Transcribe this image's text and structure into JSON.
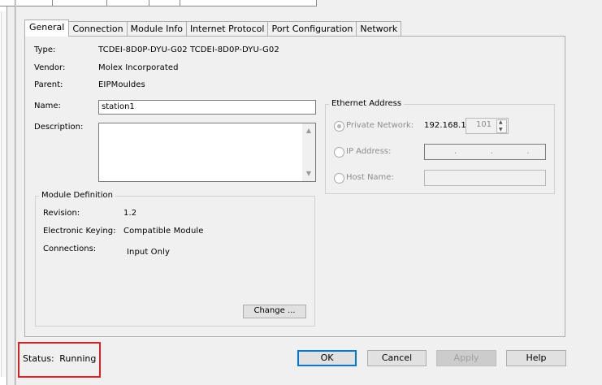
{
  "tabs": [
    {
      "label": "General",
      "active": true
    },
    {
      "label": "Connection",
      "active": false
    },
    {
      "label": "Module Info",
      "active": false
    },
    {
      "label": "Internet Protocol",
      "active": false
    },
    {
      "label": "Port Configuration",
      "active": false
    },
    {
      "label": "Network",
      "active": false
    }
  ],
  "general": {
    "type_label": "Type:",
    "type_value": "TCDEI-8D0P-DYU-G02 TCDEI-8D0P-DYU-G02",
    "vendor_label": "Vendor:",
    "vendor_value": "Molex Incorporated",
    "parent_label": "Parent:",
    "parent_value": "EIPMouldes",
    "name_label": "Name:",
    "name_value": "station1",
    "description_label": "Description:",
    "description_value": ""
  },
  "module_definition": {
    "title": "Module Definition",
    "revision_label": "Revision:",
    "revision_value": "1.2",
    "keying_label": "Electronic Keying:",
    "keying_value": "Compatible Module",
    "connections_label": "Connections:",
    "connections_value": "Input Only",
    "change_button": "Change ..."
  },
  "ethernet_address": {
    "title": "Ethernet Address",
    "private_network_label": "Private Network:",
    "private_network_prefix": "192.168.1.",
    "private_network_value": "101",
    "private_network_selected": true,
    "ip_address_label": "IP Address:",
    "ip_address_value": ".   .   .",
    "host_name_label": "Host Name:",
    "host_name_value": ""
  },
  "status": {
    "label": "Status:",
    "value": "Running"
  },
  "buttons": {
    "ok": "OK",
    "cancel": "Cancel",
    "apply": "Apply",
    "help": "Help"
  },
  "colors": {
    "highlight": "#e02020",
    "default_button_border": "#0078d7",
    "dialog_background": "#f0f0f0"
  },
  "icons": {
    "scroll_up": "scroll-up-arrow-icon",
    "scroll_down": "scroll-down-arrow-icon",
    "spin_up": "spin-up-icon",
    "spin_down": "spin-down-icon"
  }
}
